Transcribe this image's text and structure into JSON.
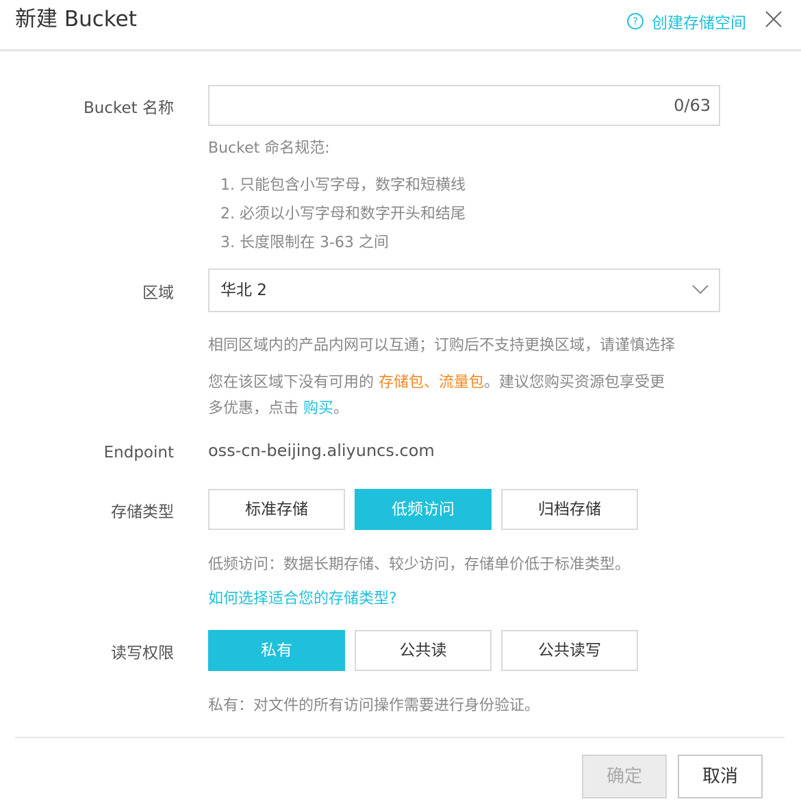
{
  "dialog": {
    "title": "新建 Bucket",
    "help_link": "创建存储空间",
    "help_icon": "question-icon",
    "close_icon": "close-icon"
  },
  "bucket_name": {
    "label": "Bucket 名称",
    "value": "",
    "counter": "0/63",
    "rules_title": "Bucket 命名规范:",
    "rules": [
      "1. 只能包含小写字母，数字和短横线",
      "2. 必须以小写字母和数字开头和结尾",
      "3. 长度限制在 3-63 之间"
    ]
  },
  "region": {
    "label": "区域",
    "selected": "华北 2",
    "hint": "相同区域内的产品内网可以互通；订购后不支持更换区域，请谨慎选择",
    "notice_prefix": "您在该区域下没有可用的 ",
    "notice_packages": "存储包、流量包",
    "notice_middle": "。建议您购买资源包享受更",
    "notice_line2_prefix": "多优惠，点击 ",
    "notice_buy": "购买",
    "notice_end": "。"
  },
  "endpoint": {
    "label": "Endpoint",
    "value": "oss-cn-beijing.aliyuncs.com"
  },
  "storage_class": {
    "label": "存储类型",
    "options": [
      "标准存储",
      "低频访问",
      "归档存储"
    ],
    "selected": "低频访问",
    "description": "低频访问：数据长期存储、较少访问，存储单价低于标准类型。",
    "help_link": "如何选择适合您的存储类型?"
  },
  "acl": {
    "label": "读写权限",
    "options": [
      "私有",
      "公共读",
      "公共读写"
    ],
    "selected": "私有",
    "description": "私有：对文件的所有访问操作需要进行身份验证。"
  },
  "footer": {
    "ok_label": "确定",
    "cancel_label": "取消"
  },
  "colors": {
    "accent": "#1fc0db",
    "highlight": "#f5871f",
    "disabled": "#ececec"
  }
}
